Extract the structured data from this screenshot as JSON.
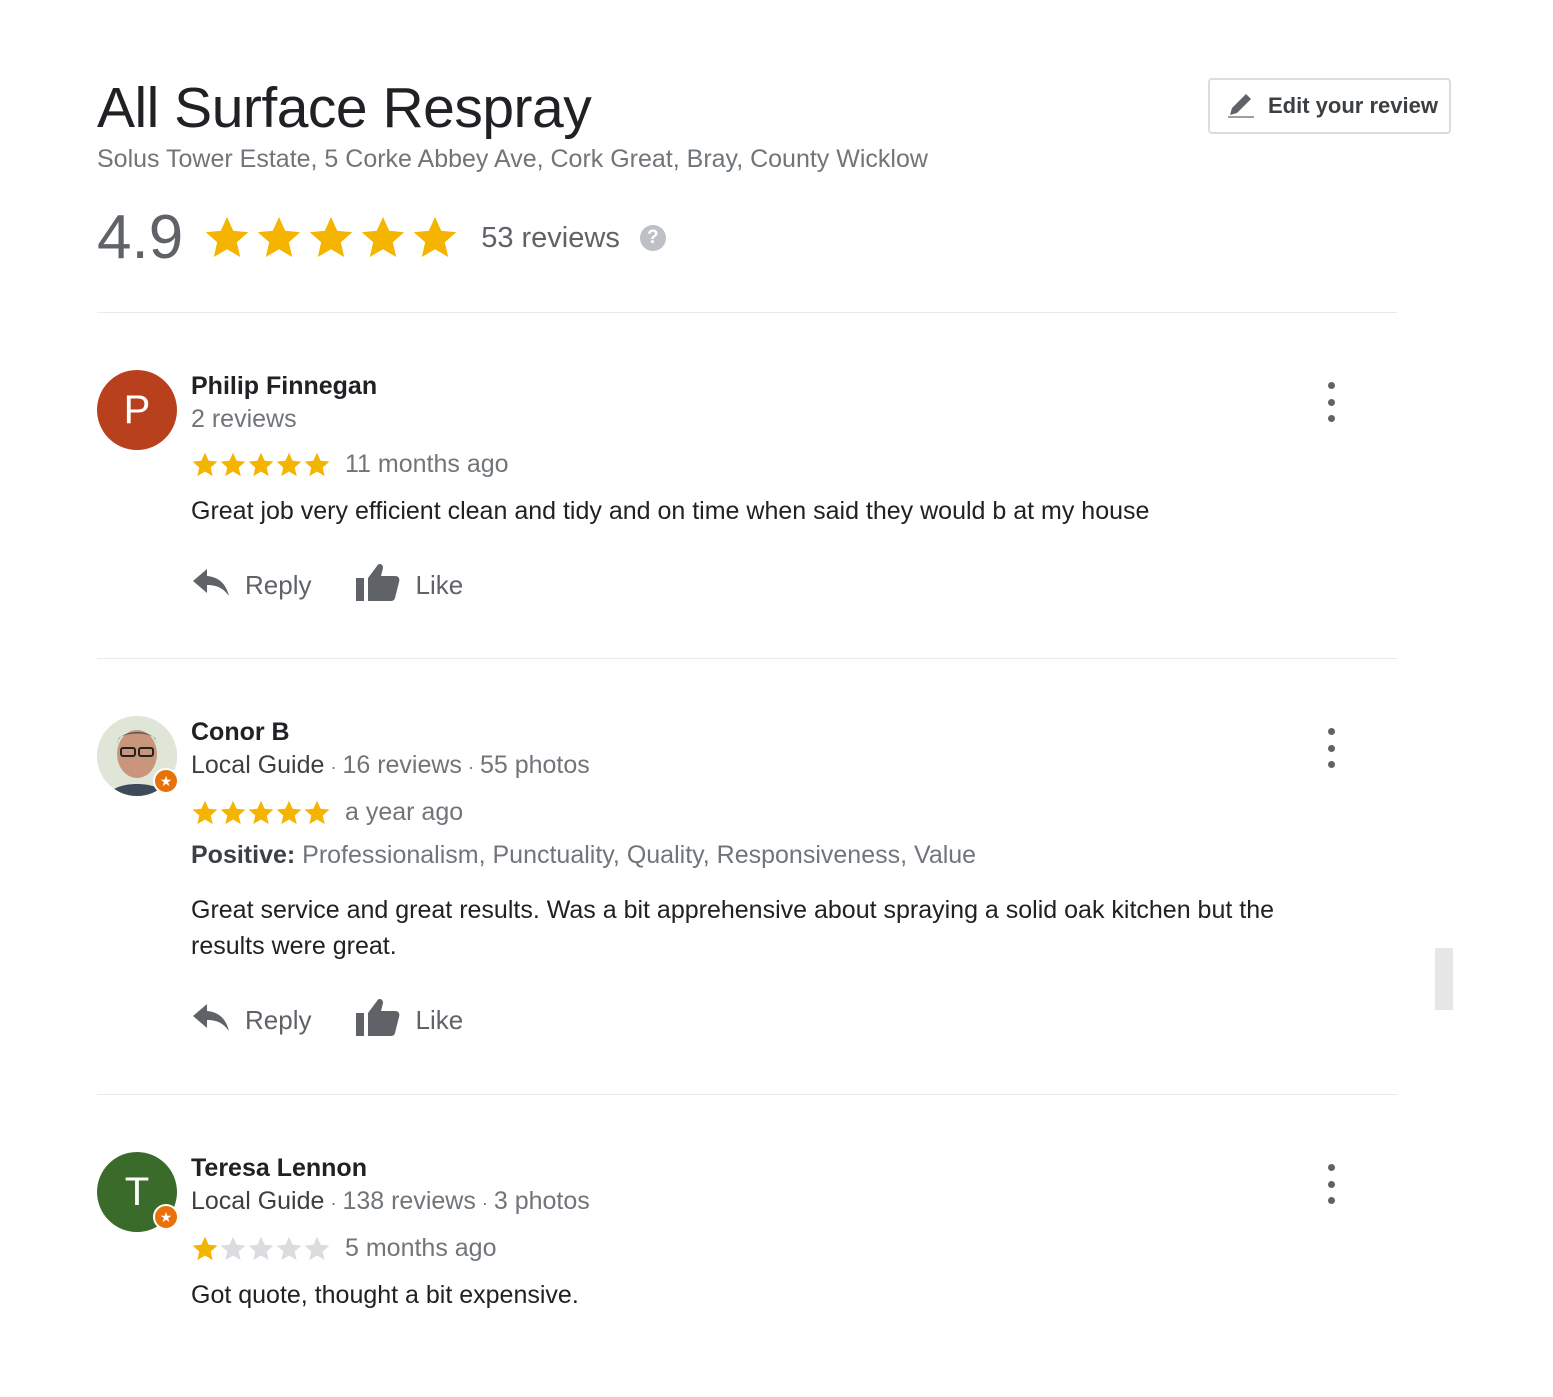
{
  "place": {
    "name": "All Surface Respray",
    "address": "Solus Tower Estate, 5 Corke Abbey Ave, Cork Great, Bray, County Wicklow"
  },
  "edit_button": {
    "label": "Edit your review",
    "icon": "pencil-icon"
  },
  "summary": {
    "score": "4.9",
    "stars": 5,
    "reviews_count": "53 reviews",
    "help_icon": "question-mark-icon",
    "help_glyph": "?"
  },
  "colors": {
    "star_filled": "#f4b400",
    "star_empty": "#dadce0",
    "guide_badge": "#e8710a"
  },
  "reviews": [
    {
      "name": "Philip Finnegan",
      "avatar_letter": "P",
      "avatar_color": "#b8401c",
      "local_guide": "",
      "reviews": "2 reviews",
      "photos": "",
      "rating": 5,
      "time": "11 months ago",
      "positive_label": "",
      "positive": "",
      "text": "Great job very efficient clean and tidy and on time when said they would b at my house",
      "reply_label": "Reply",
      "like_label": "Like"
    },
    {
      "name": "Conor B",
      "avatar_letter": "",
      "avatar_color": "#cfd6c8",
      "local_guide": "Local Guide",
      "reviews": "16 reviews",
      "photos": "55 photos",
      "rating": 5,
      "time": "a year ago",
      "positive_label": "Positive:",
      "positive": "Professionalism, Punctuality, Quality, Responsiveness, Value",
      "text": "Great service and great results. Was a bit apprehensive about spraying a solid oak kitchen but the results were great.",
      "reply_label": "Reply",
      "like_label": "Like"
    },
    {
      "name": "Teresa Lennon",
      "avatar_letter": "T",
      "avatar_color": "#3a6b2a",
      "local_guide": "Local Guide",
      "reviews": "138 reviews",
      "photos": "3 photos",
      "rating": 1,
      "time": "5 months ago",
      "positive_label": "",
      "positive": "",
      "text": "Got quote, thought a bit expensive.",
      "reply_label": "",
      "like_label": ""
    }
  ]
}
